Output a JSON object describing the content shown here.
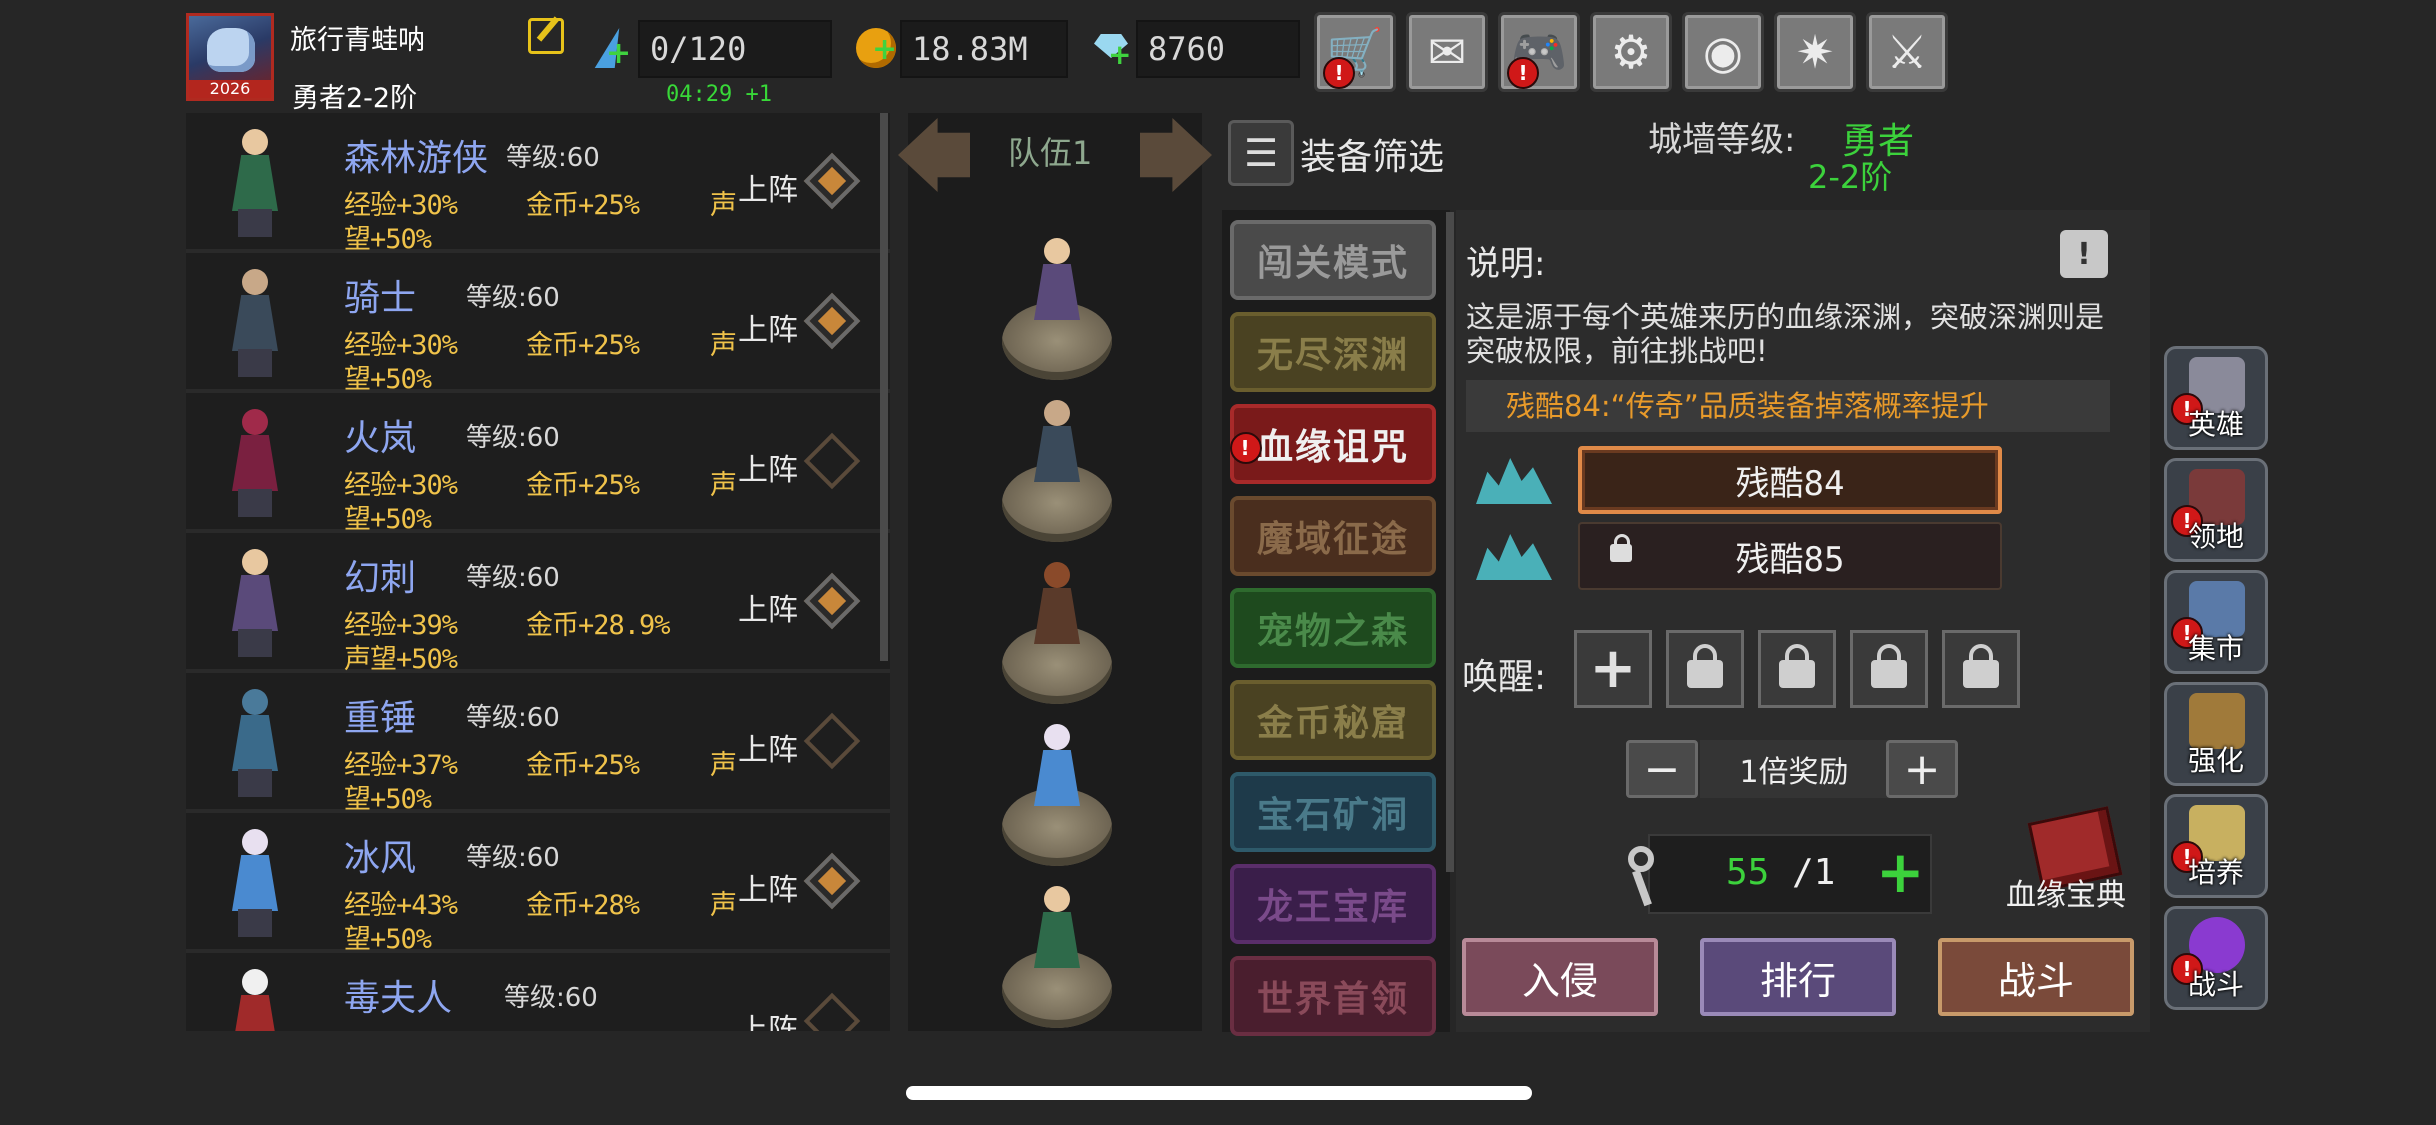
{
  "header": {
    "avatar_year": "2026",
    "player_name": "旅行青蛙呐",
    "player_rank": "勇者2-2阶",
    "energy": "0/120",
    "energy_timer": "04:29 +1",
    "gold": "18.83M",
    "gems": "8760",
    "toolbar": [
      {
        "icon": "cart-icon",
        "glyph": "🛒",
        "alert": "!"
      },
      {
        "icon": "mail-icon",
        "glyph": "✉",
        "alert": ""
      },
      {
        "icon": "gamepad-icon",
        "glyph": "🎮",
        "alert": "!"
      },
      {
        "icon": "gear-icon",
        "glyph": "⚙",
        "alert": ""
      },
      {
        "icon": "color-wheel-icon",
        "glyph": "◉",
        "alert": ""
      },
      {
        "icon": "fireworks-icon",
        "glyph": "✷",
        "alert": ""
      },
      {
        "icon": "crossed-swords-icon",
        "glyph": "⚔",
        "alert": ""
      }
    ]
  },
  "heroes": [
    {
      "name": "森林游侠",
      "level": "等级:60",
      "exp": "经验+30%",
      "gold": "金币+25%",
      "fame_a": "声",
      "fame_b": "望+50%",
      "deploy": "上阵",
      "equipped": true,
      "colors": {
        "head": "#e8c8a0",
        "body": "#2e6a4a"
      }
    },
    {
      "name": "骑士",
      "level": "等级:60",
      "exp": "经验+30%",
      "gold": "金币+25%",
      "fame_a": "声",
      "fame_b": "望+50%",
      "deploy": "上阵",
      "equipped": true,
      "colors": {
        "head": "#c8a888",
        "body": "#3a4a5a"
      }
    },
    {
      "name": "火岚",
      "level": "等级:60",
      "exp": "经验+30%",
      "gold": "金币+25%",
      "fame_a": "声",
      "fame_b": "望+50%",
      "deploy": "上阵",
      "equipped": false,
      "colors": {
        "head": "#a02a4a",
        "body": "#7a2040"
      }
    },
    {
      "name": "幻刺",
      "level": "等级:60",
      "exp": "经验+39%",
      "gold": "金币+28.9%",
      "fame_a": "",
      "fame_b": "声望+50%",
      "deploy": "上阵",
      "equipped": true,
      "colors": {
        "head": "#e8c8a0",
        "body": "#5a4a7a"
      }
    },
    {
      "name": "重锤",
      "level": "等级:60",
      "exp": "经验+37%",
      "gold": "金币+25%",
      "fame_a": "声",
      "fame_b": "望+50%",
      "deploy": "上阵",
      "equipped": false,
      "colors": {
        "head": "#4a7a9a",
        "body": "#3a6a8a"
      }
    },
    {
      "name": "冰风",
      "level": "等级:60",
      "exp": "经验+43%",
      "gold": "金币+28%",
      "fame_a": "声",
      "fame_b": "望+50%",
      "deploy": "上阵",
      "equipped": true,
      "colors": {
        "head": "#e8e0f0",
        "body": "#4a8ad0"
      }
    },
    {
      "name": "毒夫人",
      "level": "等级:60",
      "exp": "",
      "gold": "",
      "fame_a": "",
      "fame_b": "",
      "deploy": "上阵",
      "equipped": false,
      "colors": {
        "head": "#f0f0f0",
        "body": "#a02a2a"
      }
    }
  ],
  "team": {
    "title": "队伍1",
    "members": [
      {
        "head": "#e8c8a0",
        "body": "#5a4a7a"
      },
      {
        "head": "#c8a888",
        "body": "#3a4a5a"
      },
      {
        "head": "#8a4a2a",
        "body": "#5a3a2a"
      },
      {
        "head": "#e8e0f0",
        "body": "#4a8ad0"
      },
      {
        "head": "#e8c8a0",
        "body": "#2e6a4a"
      }
    ]
  },
  "filter": {
    "label": "装备筛选"
  },
  "wall": {
    "label": "城墙等级:",
    "rank_title": "勇者",
    "rank_tier": "2-2阶"
  },
  "modes": [
    {
      "label": "闯关模式",
      "bg": "#4a4a4a",
      "border": "#6a6a6a",
      "color": "#9a9a9a",
      "alert": ""
    },
    {
      "label": "无尽深渊",
      "bg": "#4a4222",
      "border": "#6a5e2e",
      "color": "#8a7e4a",
      "alert": ""
    },
    {
      "label": "血缘诅咒",
      "bg": "#7a1a1a",
      "border": "#a82a2a",
      "color": "#f0f0f0",
      "alert": "!"
    },
    {
      "label": "魔域征途",
      "bg": "#4a2e1e",
      "border": "#6a4a2e",
      "color": "#8a6a4a",
      "alert": ""
    },
    {
      "label": "宠物之森",
      "bg": "#1e4a1e",
      "border": "#2e6a2e",
      "color": "#4a8a4a",
      "alert": ""
    },
    {
      "label": "金币秘窟",
      "bg": "#4a4222",
      "border": "#6a5e2e",
      "color": "#8a7e4a",
      "alert": ""
    },
    {
      "label": "宝石矿洞",
      "bg": "#1e3a4a",
      "border": "#2e5a6a",
      "color": "#4a7a8a",
      "alert": ""
    },
    {
      "label": "龙王宝库",
      "bg": "#3a1e4a",
      "border": "#5a2e6a",
      "color": "#7a4a8a",
      "alert": ""
    },
    {
      "label": "世界首领",
      "bg": "#4a1e2e",
      "border": "#6a2e42",
      "color": "#8a4a5a",
      "alert": ""
    }
  ],
  "panel": {
    "desc_title": "说明:",
    "help": "!",
    "desc_text": "这是源于每个英雄来历的血缘深渊，突破深渊则是突破极限，前往挑战吧!",
    "bonus": "残酷84:“传奇”品质装备掉落概率提升",
    "stages": [
      {
        "label": "残酷84",
        "locked": false
      },
      {
        "label": "残酷85",
        "locked": true
      }
    ],
    "awaken_label": "唤醒:",
    "awaken_slots": [
      "plus",
      "lock",
      "lock",
      "lock",
      "lock"
    ],
    "multiplier": "1倍奖励",
    "tickets_have": "55",
    "tickets_sep": "/1",
    "tickets_add": "+",
    "codex_label": "血缘宝典",
    "actions": [
      {
        "label": "入侵",
        "bg": "#7a4a5a",
        "border": "#b88a98"
      },
      {
        "label": "排行",
        "bg": "#5a4a7a",
        "border": "#9a8ab8"
      },
      {
        "label": "战斗",
        "bg": "#7a4a3a",
        "border": "#c89a6a"
      }
    ]
  },
  "sidebar": [
    {
      "label": "英雄",
      "icon": "helmet-icon",
      "alert": "!",
      "color": "#8a8a9a"
    },
    {
      "label": "领地",
      "icon": "castle-icon",
      "alert": "!",
      "color": "#7a3a3a"
    },
    {
      "label": "集市",
      "icon": "market-icon",
      "alert": "!",
      "color": "#5a7aa8"
    },
    {
      "label": "强化",
      "icon": "enhance-crystal-icon",
      "alert": "",
      "color": "#a07a3a"
    },
    {
      "label": "培养",
      "icon": "chalice-icon",
      "alert": "!",
      "color": "#c8b060"
    },
    {
      "label": "战斗",
      "icon": "portal-icon",
      "alert": "!",
      "color": "#8a3ad0"
    }
  ]
}
